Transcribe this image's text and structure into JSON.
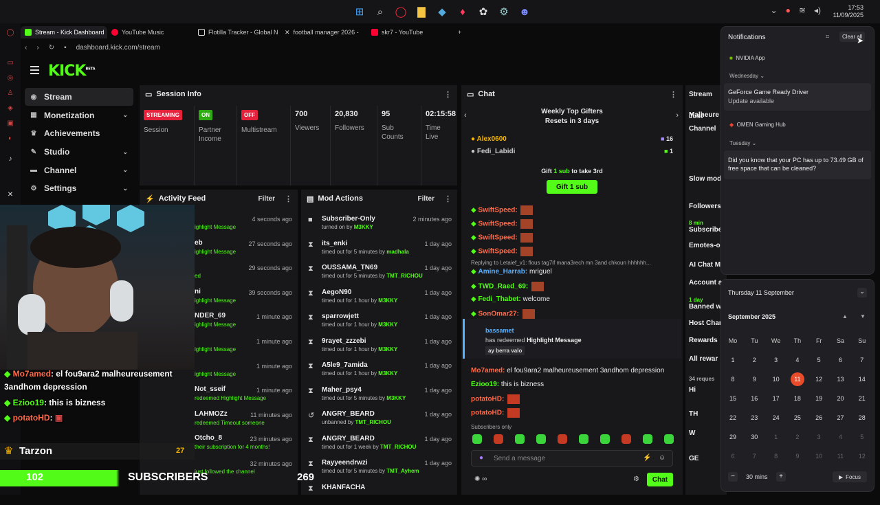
{
  "taskbar": {
    "time": "17:53",
    "date": "11/09/2025"
  },
  "browser": {
    "tabs": [
      {
        "label": "Stream - Kick Dashboard",
        "color": "#53fc18",
        "active": true
      },
      {
        "label": "YouTube Music",
        "color": "#ff0033"
      },
      {
        "label": "Flotilla Tracker - Global N",
        "color": "#dddddd"
      },
      {
        "label": "football manager 2026 -",
        "color": "#dddddd"
      },
      {
        "label": "skr7 - YouTube",
        "color": "#ff0033"
      }
    ],
    "address": "dashboard.kick.com/stream"
  },
  "kick": {
    "logo": "KICK",
    "logo_tag": "BETA",
    "nav": [
      {
        "label": "Stream",
        "active": true,
        "chevron": false
      },
      {
        "label": "Monetization",
        "chevron": true
      },
      {
        "label": "Achievements",
        "chevron": false
      },
      {
        "label": "Studio",
        "chevron": true
      },
      {
        "label": "Channel",
        "chevron": true
      },
      {
        "label": "Settings",
        "chevron": true
      }
    ]
  },
  "session": {
    "title": "Session Info",
    "stats": [
      {
        "badge": "STREAMING",
        "badge_color": "#e5223c",
        "label": "Session"
      },
      {
        "badge": "ON",
        "badge_color": "#2eab12",
        "label": "Partner Income"
      },
      {
        "badge": "OFF",
        "badge_color": "#e5223c",
        "label": "Multistream"
      },
      {
        "value": "700",
        "label": "Viewers"
      },
      {
        "value": "20,830",
        "label": "Followers"
      },
      {
        "value": "95",
        "label": "Sub Counts"
      },
      {
        "value": "02:15:58",
        "label": "Time Live"
      }
    ]
  },
  "activity": {
    "title": "Activity Feed",
    "filter": "Filter",
    "rows": [
      {
        "name": "",
        "sub": "ighlight Message",
        "time": "4 seconds ago"
      },
      {
        "name": "eb",
        "sub": "ighlight Message",
        "time": "27 seconds ago"
      },
      {
        "name": "",
        "sub": "ed",
        "time": "29 seconds ago"
      },
      {
        "name": "ni",
        "sub": "ighlight Message",
        "time": "39 seconds ago"
      },
      {
        "name": "NDER_69",
        "sub": "ighlight Message",
        "time": "1 minute ago"
      },
      {
        "name": "",
        "sub": "ighlight Message",
        "time": "1 minute ago"
      },
      {
        "name": "",
        "sub": "ighlight Message",
        "time": "1 minute ago"
      },
      {
        "name": "Not_sseif",
        "sub": "redeemed Highlight Message",
        "time": "1 minute ago"
      },
      {
        "name": "LAHMOZz",
        "sub": "redeemed Timeout someone",
        "time": "11 minutes ago"
      },
      {
        "name": "Otcho_8",
        "sub": "their subscription for 4 months!",
        "time": "23 minutes ago"
      },
      {
        "name": "",
        "sub": "just followed the channel",
        "time": "32 minutes ago"
      }
    ]
  },
  "mod": {
    "title": "Mod Actions",
    "filter": "Filter",
    "rows": [
      {
        "icon": "■",
        "name": "Subscriber-Only",
        "sub_pre": "turned on by",
        "by": "M3KKY",
        "time": "2 minutes ago"
      },
      {
        "icon": "⧗",
        "name": "its_enki",
        "sub_pre": "timed out for 5 minutes by",
        "by": "madhala",
        "time": "1 day ago"
      },
      {
        "icon": "⧗",
        "name": "OUSSAMA_TN69",
        "sub_pre": "timed out for 5 minutes by",
        "by": "TMT_RICHOU",
        "time": "1 day ago"
      },
      {
        "icon": "⧗",
        "name": "AegoN90",
        "sub_pre": "timed out for 1 hour by",
        "by": "M3KKY",
        "time": "1 day ago"
      },
      {
        "icon": "⧗",
        "name": "sparrowjett",
        "sub_pre": "timed out for 1 hour by",
        "by": "M3KKY",
        "time": "1 day ago"
      },
      {
        "icon": "⧗",
        "name": "9rayet_zzzebi",
        "sub_pre": "timed out for 1 hour by",
        "by": "M3KKY",
        "time": "1 day ago"
      },
      {
        "icon": "⧗",
        "name": "A5le9_7amida",
        "sub_pre": "timed out for 1 hour by",
        "by": "M3KKY",
        "time": "1 day ago"
      },
      {
        "icon": "⧗",
        "name": "Maher_psy4",
        "sub_pre": "timed out for 5 minutes by",
        "by": "M3KKY",
        "time": "1 day ago"
      },
      {
        "icon": "↺",
        "name": "ANGRY_BEARD",
        "sub_pre": "unbanned by",
        "by": "TMT_RICHOU",
        "time": "1 day ago"
      },
      {
        "icon": "⧗",
        "name": "ANGRY_BEARD",
        "sub_pre": "timed out for 1 week by",
        "by": "TMT_RICHOU",
        "time": "1 day ago"
      },
      {
        "icon": "⧗",
        "name": "Rayyeendrwzi",
        "sub_pre": "timed out for 5 minutes by",
        "by": "TMT_Ayhem",
        "time": "1 day ago"
      },
      {
        "icon": "⧗",
        "name": "KHANFACHA",
        "sub_pre": "",
        "by": "",
        "time": ""
      }
    ]
  },
  "chat": {
    "title": "Chat",
    "gifters_title": "Weekly Top Gifters",
    "gifters_sub": "Resets in 3 days",
    "gifters": [
      {
        "name": "Alex0600",
        "count": "16",
        "color": "#f2b400"
      },
      {
        "name": "Fedi_Labidi",
        "count": "1",
        "color": "#cccccc"
      }
    ],
    "gift_prompt_pre": "Gift",
    "gift_prompt_mid": "1 sub",
    "gift_prompt_post": "to take 3rd",
    "gift_button": "Gift 1 sub",
    "messages": [
      {
        "user": "SwiftSpeed:",
        "color": "#ff6b4a",
        "text": ""
      },
      {
        "user": "SwiftSpeed:",
        "color": "#ff6b4a",
        "text": ""
      },
      {
        "user": "SwiftSpeed:",
        "color": "#ff6b4a",
        "text": ""
      },
      {
        "user": "SwiftSpeed:",
        "color": "#ff6b4a",
        "text": ""
      },
      {
        "user": "",
        "color": "#aaaaaa",
        "text": "Replying to Letaief_v1: flous tag7if mana3rech mn 3and chkoun hhhhhh..."
      },
      {
        "user": "Amine_Harrab:",
        "color": "#5ab1ff",
        "text": "mriguel"
      },
      {
        "user": "TWD_Raed_69:",
        "color": "#53fc18",
        "text": ""
      },
      {
        "user": "Fedi_Thabet:",
        "color": "#53fc18",
        "text": "welcome"
      },
      {
        "user": "SonOmar27:",
        "color": "#ff6b4a",
        "text": ""
      }
    ],
    "redeem_user": "bassamet",
    "redeem_pre": "has redeemed",
    "redeem_what": "Highlight Message",
    "redeem_msg": "ay berra valo",
    "messages2": [
      {
        "user": "Mo7amed:",
        "color": "#ff6b4a",
        "text": "el fou9ara2 malheureusement 3andhom depression"
      },
      {
        "user": "Ezioo19:",
        "color": "#53fc18",
        "text": "this is bizness"
      },
      {
        "user": "potatoHD:",
        "color": "#ff6b4a",
        "text": ""
      },
      {
        "user": "potatoHD:",
        "color": "#ff6b4a",
        "text": ""
      }
    ],
    "subs_only": "Subscribers only",
    "send_placeholder": "Send a message",
    "send_button": "Chat"
  },
  "streamcol": {
    "title": "Stream",
    "items": [
      "Malheure",
      "Just",
      "Channel",
      "Slow mode",
      "Followers-",
      "8 min",
      "Subscriber",
      "Emotes-or",
      "AI Chat Mo",
      "Account a",
      "1 day",
      "Banned w",
      "Host Chan",
      "Rewards",
      "All rewar",
      "34 reques",
      "Hi",
      "TH",
      "W",
      "GE"
    ]
  },
  "notifications": {
    "title": "Notifications",
    "clear_all": "Clear all",
    "groups": [
      {
        "app": "NVIDIA App"
      },
      {
        "day": "Wednesday"
      },
      {
        "title": "GeForce Game Ready Driver",
        "body": "Update available"
      },
      {
        "app": "OMEN Gaming Hub"
      },
      {
        "day": "Tuesday"
      },
      {
        "body": "Did you know that your PC has up to 73.49 GB of free space that can be cleaned?"
      }
    ]
  },
  "calendar": {
    "header": "Thursday 11 September",
    "month": "September 2025",
    "weekdays": [
      "Mo",
      "Tu",
      "We",
      "Th",
      "Fr",
      "Sa",
      "Su"
    ],
    "days": [
      "1",
      "2",
      "3",
      "4",
      "5",
      "6",
      "7",
      "8",
      "9",
      "10",
      "11",
      "12",
      "13",
      "14",
      "15",
      "16",
      "17",
      "18",
      "19",
      "20",
      "21",
      "22",
      "23",
      "24",
      "25",
      "26",
      "27",
      "28",
      "29",
      "30",
      "1",
      "2",
      "3",
      "4",
      "5",
      "6",
      "7",
      "8",
      "9",
      "10",
      "11",
      "12"
    ],
    "today": "11",
    "focus_minutes": "30",
    "focus_unit": "mins",
    "focus_label": "Focus"
  },
  "overlay": {
    "chat": [
      {
        "user": "Mo7amed",
        "color": "#ff6b4a",
        "text": ": el fou9ara2 malheureusement"
      },
      {
        "user": "",
        "color": "#ffffff",
        "text": "3andhom depression"
      },
      {
        "user": "Ezioo19",
        "color": "#53fc18",
        "text": ": this is bizness"
      },
      {
        "user": "potatoHD",
        "color": "#ff6b4a",
        "text": ":"
      }
    ],
    "top_gifter": "Tarzon",
    "top_gifter_count": "27",
    "subs_count": "102",
    "subs_label": "SUBSCRIBERS",
    "subs_goal": "269"
  }
}
